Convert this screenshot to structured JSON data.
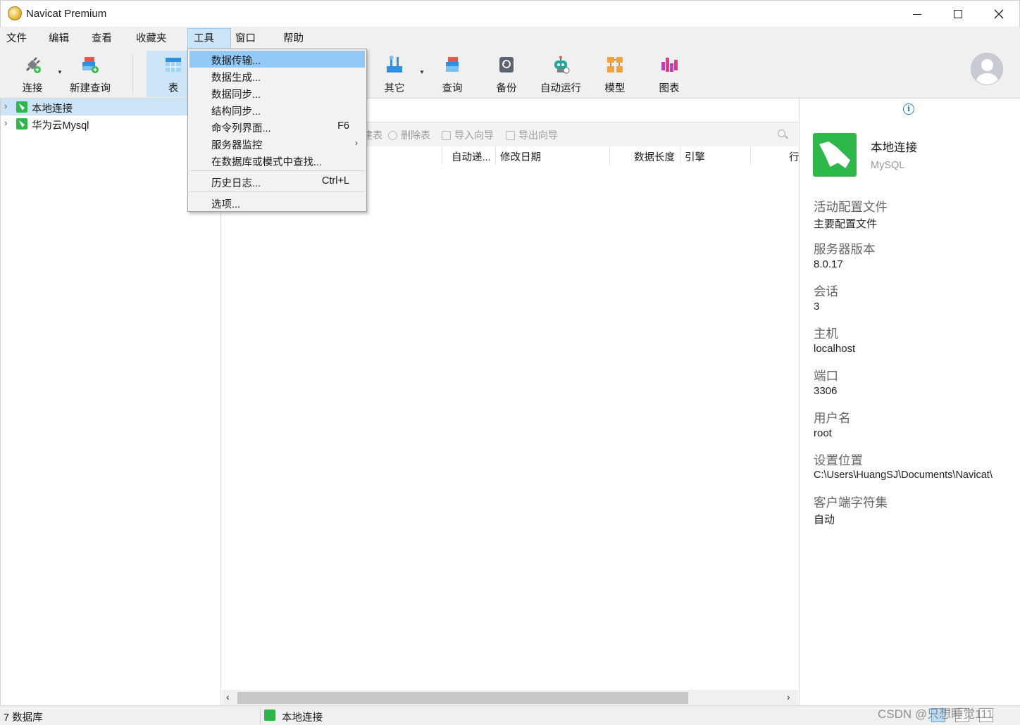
{
  "window": {
    "title": "Navicat Premium",
    "controls": {
      "minimize": "—",
      "maximize": "☐",
      "close": "✕"
    }
  },
  "menubar": {
    "items": [
      "文件",
      "编辑",
      "查看",
      "收藏夹",
      "工具",
      "窗口",
      "帮助"
    ],
    "active": "工具"
  },
  "toolbar": {
    "buttons": [
      {
        "label": "连接",
        "icon": "plug-icon"
      },
      {
        "label": "新建查询",
        "icon": "new-query-icon"
      },
      {
        "label": "表",
        "icon": "table-icon"
      },
      {
        "label": "其它",
        "icon": "tools-icon"
      },
      {
        "label": "查询",
        "icon": "query-icon"
      },
      {
        "label": "备份",
        "icon": "backup-icon"
      },
      {
        "label": "自动运行",
        "icon": "robot-icon"
      },
      {
        "label": "模型",
        "icon": "model-icon"
      },
      {
        "label": "图表",
        "icon": "chart-icon"
      }
    ],
    "active": "表"
  },
  "navigation": {
    "connections": [
      {
        "label": "本地连接",
        "selected": true
      },
      {
        "label": "华为云Mysql",
        "selected": false
      }
    ]
  },
  "tools_menu": {
    "items": [
      {
        "label": "数据传输...",
        "shortcut": "",
        "highlighted": true
      },
      {
        "label": "数据生成...",
        "shortcut": ""
      },
      {
        "label": "数据同步...",
        "shortcut": ""
      },
      {
        "label": "结构同步...",
        "shortcut": ""
      },
      {
        "label": "命令列界面...",
        "shortcut": "F6"
      },
      {
        "label": "服务器监控",
        "shortcut": "",
        "submenu": true
      },
      {
        "label": "在数据库或模式中查找...",
        "shortcut": ""
      },
      {
        "label": "历史日志...",
        "shortcut": "Ctrl+L"
      },
      {
        "label": "选项...",
        "shortcut": ""
      }
    ]
  },
  "main": {
    "actions": [
      {
        "label": "建表",
        "icon": "design-table-icon"
      },
      {
        "label": "删除表",
        "icon": "delete-table-icon"
      },
      {
        "label": "导入向导",
        "icon": "import-icon"
      },
      {
        "label": "导出向导",
        "icon": "export-icon"
      }
    ],
    "columns": [
      "自动递...",
      "修改日期",
      "数据长度",
      "引擎",
      "行"
    ]
  },
  "info_panel": {
    "title": "本地连接",
    "subtitle": "MySQL",
    "fields": [
      {
        "label": "活动配置文件",
        "value": "主要配置文件"
      },
      {
        "label": "服务器版本",
        "value": "8.0.17"
      },
      {
        "label": "会话",
        "value": "3"
      },
      {
        "label": "主机",
        "value": "localhost"
      },
      {
        "label": "端口",
        "value": "3306"
      },
      {
        "label": "用户名",
        "value": "root"
      },
      {
        "label": "设置位置",
        "value": "C:\\Users\\HuangSJ\\Documents\\Navicat\\"
      },
      {
        "label": "客户端字符集",
        "value": "自动"
      }
    ]
  },
  "statusbar": {
    "count": "7 数据库",
    "connection": "本地连接"
  },
  "watermark": "CSDN @只想睡觉111",
  "colors": {
    "selection": "#cce4f7",
    "menu_highlight": "#91c9f7",
    "navicat_green": "#2fb84a"
  }
}
